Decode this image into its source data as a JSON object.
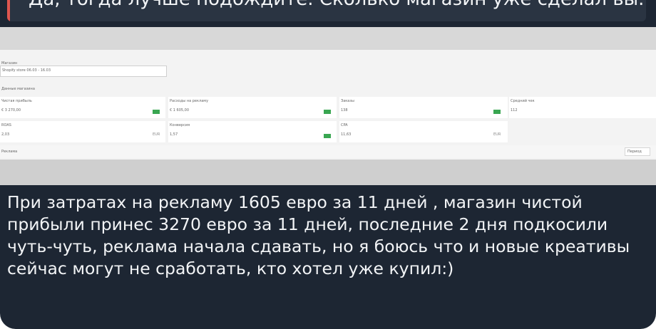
{
  "reply": {
    "text": "Да, тогда лучше подождите. Сколько магазин уже сделал вы..."
  },
  "screenshot": {
    "field_label": "Магазин",
    "field_value": "Shopify store 06.03 - 16.03",
    "section_title": "Данные магазина",
    "cards": [
      {
        "label": "Чистая прибыль",
        "value": "€ 3 270,00"
      },
      {
        "label": "Расходы на рекламу",
        "value": "€ 1 605,00"
      },
      {
        "label": "Заказы",
        "value": "138"
      },
      {
        "label": "Средний чек",
        "value": "112"
      },
      {
        "label": "ROAS",
        "value": "2,03",
        "unit": "EUR"
      },
      {
        "label": "Конверсия",
        "value": "1,57",
        "unit": ""
      },
      {
        "label": "CPA",
        "value": "11,63",
        "unit": "EUR"
      }
    ],
    "bottom_title": "Реклама",
    "bottom_select": "Период"
  },
  "message": {
    "text": "При затратах на рекламу 1605 евро за 11 дней , магазин чистой прибыли принес 3270 евро за 11 дней, последние 2 дня подкосили чуть-чуть, реклама начала сдавать, но я боюсь что и новые креативы сейчас могут не сработать, кто хотел уже купил:)"
  }
}
